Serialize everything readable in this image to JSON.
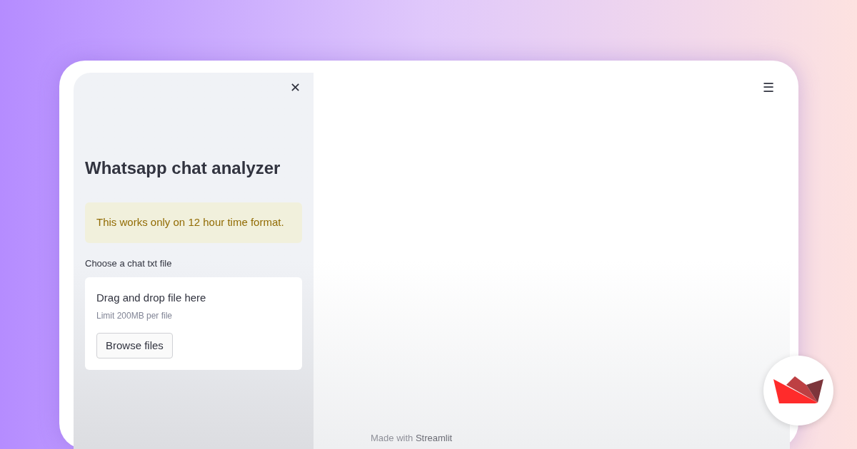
{
  "sidebar": {
    "close": "✕",
    "title": "Whatsapp chat analyzer",
    "alert": "This works only on 12 hour time format.",
    "uploader": {
      "label": "Choose a chat txt file",
      "prompt": "Drag and drop file here",
      "limit": "Limit 200MB per file",
      "button": "Browse files"
    }
  },
  "main": {
    "menu": "☰"
  },
  "footer": {
    "prefix": "Made with",
    "link": "Streamlit"
  }
}
